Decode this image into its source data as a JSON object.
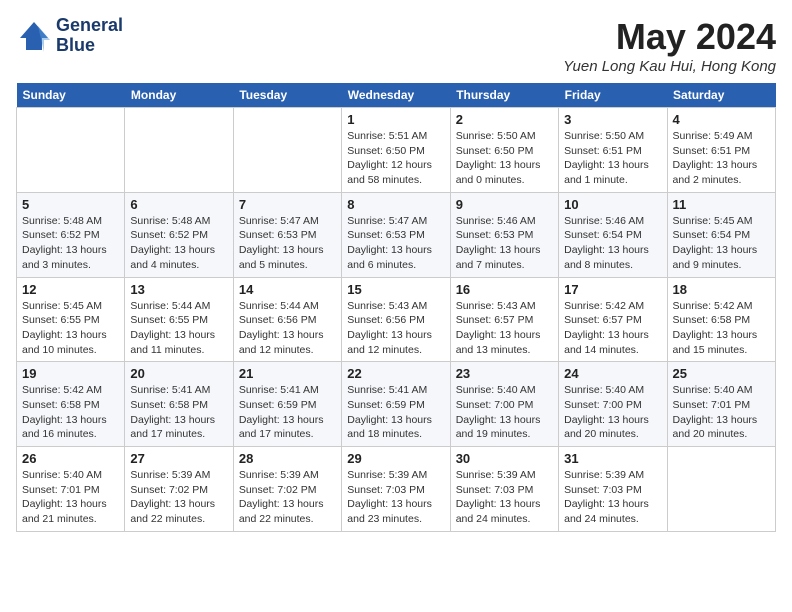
{
  "header": {
    "logo_text_line1": "General",
    "logo_text_line2": "Blue",
    "month_title": "May 2024",
    "location": "Yuen Long Kau Hui, Hong Kong"
  },
  "weekdays": [
    "Sunday",
    "Monday",
    "Tuesday",
    "Wednesday",
    "Thursday",
    "Friday",
    "Saturday"
  ],
  "weeks": [
    [
      {
        "day": "",
        "info": ""
      },
      {
        "day": "",
        "info": ""
      },
      {
        "day": "",
        "info": ""
      },
      {
        "day": "1",
        "info": "Sunrise: 5:51 AM\nSunset: 6:50 PM\nDaylight: 12 hours\nand 58 minutes."
      },
      {
        "day": "2",
        "info": "Sunrise: 5:50 AM\nSunset: 6:50 PM\nDaylight: 13 hours\nand 0 minutes."
      },
      {
        "day": "3",
        "info": "Sunrise: 5:50 AM\nSunset: 6:51 PM\nDaylight: 13 hours\nand 1 minute."
      },
      {
        "day": "4",
        "info": "Sunrise: 5:49 AM\nSunset: 6:51 PM\nDaylight: 13 hours\nand 2 minutes."
      }
    ],
    [
      {
        "day": "5",
        "info": "Sunrise: 5:48 AM\nSunset: 6:52 PM\nDaylight: 13 hours\nand 3 minutes."
      },
      {
        "day": "6",
        "info": "Sunrise: 5:48 AM\nSunset: 6:52 PM\nDaylight: 13 hours\nand 4 minutes."
      },
      {
        "day": "7",
        "info": "Sunrise: 5:47 AM\nSunset: 6:53 PM\nDaylight: 13 hours\nand 5 minutes."
      },
      {
        "day": "8",
        "info": "Sunrise: 5:47 AM\nSunset: 6:53 PM\nDaylight: 13 hours\nand 6 minutes."
      },
      {
        "day": "9",
        "info": "Sunrise: 5:46 AM\nSunset: 6:53 PM\nDaylight: 13 hours\nand 7 minutes."
      },
      {
        "day": "10",
        "info": "Sunrise: 5:46 AM\nSunset: 6:54 PM\nDaylight: 13 hours\nand 8 minutes."
      },
      {
        "day": "11",
        "info": "Sunrise: 5:45 AM\nSunset: 6:54 PM\nDaylight: 13 hours\nand 9 minutes."
      }
    ],
    [
      {
        "day": "12",
        "info": "Sunrise: 5:45 AM\nSunset: 6:55 PM\nDaylight: 13 hours\nand 10 minutes."
      },
      {
        "day": "13",
        "info": "Sunrise: 5:44 AM\nSunset: 6:55 PM\nDaylight: 13 hours\nand 11 minutes."
      },
      {
        "day": "14",
        "info": "Sunrise: 5:44 AM\nSunset: 6:56 PM\nDaylight: 13 hours\nand 12 minutes."
      },
      {
        "day": "15",
        "info": "Sunrise: 5:43 AM\nSunset: 6:56 PM\nDaylight: 13 hours\nand 12 minutes."
      },
      {
        "day": "16",
        "info": "Sunrise: 5:43 AM\nSunset: 6:57 PM\nDaylight: 13 hours\nand 13 minutes."
      },
      {
        "day": "17",
        "info": "Sunrise: 5:42 AM\nSunset: 6:57 PM\nDaylight: 13 hours\nand 14 minutes."
      },
      {
        "day": "18",
        "info": "Sunrise: 5:42 AM\nSunset: 6:58 PM\nDaylight: 13 hours\nand 15 minutes."
      }
    ],
    [
      {
        "day": "19",
        "info": "Sunrise: 5:42 AM\nSunset: 6:58 PM\nDaylight: 13 hours\nand 16 minutes."
      },
      {
        "day": "20",
        "info": "Sunrise: 5:41 AM\nSunset: 6:58 PM\nDaylight: 13 hours\nand 17 minutes."
      },
      {
        "day": "21",
        "info": "Sunrise: 5:41 AM\nSunset: 6:59 PM\nDaylight: 13 hours\nand 17 minutes."
      },
      {
        "day": "22",
        "info": "Sunrise: 5:41 AM\nSunset: 6:59 PM\nDaylight: 13 hours\nand 18 minutes."
      },
      {
        "day": "23",
        "info": "Sunrise: 5:40 AM\nSunset: 7:00 PM\nDaylight: 13 hours\nand 19 minutes."
      },
      {
        "day": "24",
        "info": "Sunrise: 5:40 AM\nSunset: 7:00 PM\nDaylight: 13 hours\nand 20 minutes."
      },
      {
        "day": "25",
        "info": "Sunrise: 5:40 AM\nSunset: 7:01 PM\nDaylight: 13 hours\nand 20 minutes."
      }
    ],
    [
      {
        "day": "26",
        "info": "Sunrise: 5:40 AM\nSunset: 7:01 PM\nDaylight: 13 hours\nand 21 minutes."
      },
      {
        "day": "27",
        "info": "Sunrise: 5:39 AM\nSunset: 7:02 PM\nDaylight: 13 hours\nand 22 minutes."
      },
      {
        "day": "28",
        "info": "Sunrise: 5:39 AM\nSunset: 7:02 PM\nDaylight: 13 hours\nand 22 minutes."
      },
      {
        "day": "29",
        "info": "Sunrise: 5:39 AM\nSunset: 7:03 PM\nDaylight: 13 hours\nand 23 minutes."
      },
      {
        "day": "30",
        "info": "Sunrise: 5:39 AM\nSunset: 7:03 PM\nDaylight: 13 hours\nand 24 minutes."
      },
      {
        "day": "31",
        "info": "Sunrise: 5:39 AM\nSunset: 7:03 PM\nDaylight: 13 hours\nand 24 minutes."
      },
      {
        "day": "",
        "info": ""
      }
    ]
  ]
}
